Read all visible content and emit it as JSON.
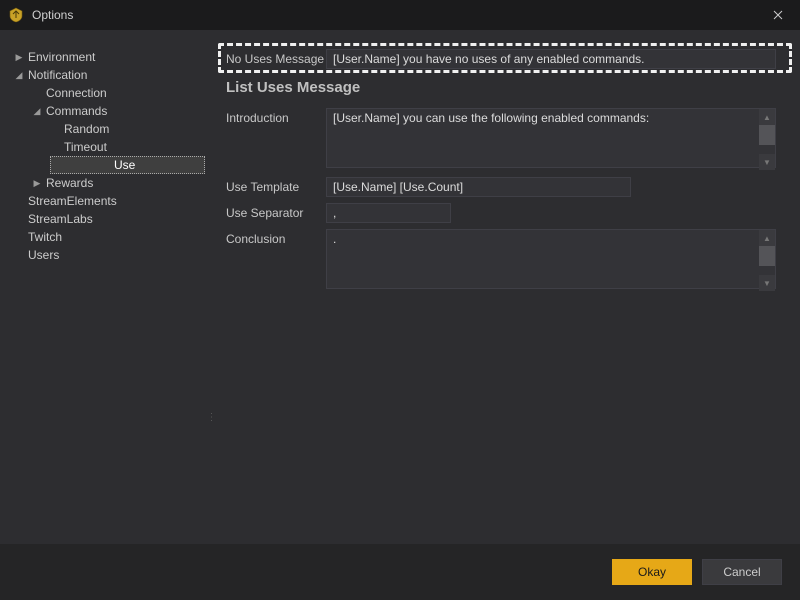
{
  "window": {
    "title": "Options"
  },
  "tree": {
    "environment": "Environment",
    "notification": "Notification",
    "connection": "Connection",
    "commands": "Commands",
    "random": "Random",
    "timeout": "Timeout",
    "use": "Use",
    "rewards": "Rewards",
    "streamelements": "StreamElements",
    "streamlabs": "StreamLabs",
    "twitch": "Twitch",
    "users": "Users"
  },
  "form": {
    "no_uses_label": "No Uses Message",
    "no_uses_value": "[User.Name] you have no uses of any enabled commands.",
    "section_title": "List Uses Message",
    "introduction_label": "Introduction",
    "introduction_value": "[User.Name] you can use the following enabled commands:",
    "use_template_label": "Use Template",
    "use_template_value": "[Use.Name] [Use.Count]",
    "use_separator_label": "Use Separator",
    "use_separator_value": ",",
    "conclusion_label": "Conclusion",
    "conclusion_value": "."
  },
  "footer": {
    "okay": "Okay",
    "cancel": "Cancel"
  }
}
